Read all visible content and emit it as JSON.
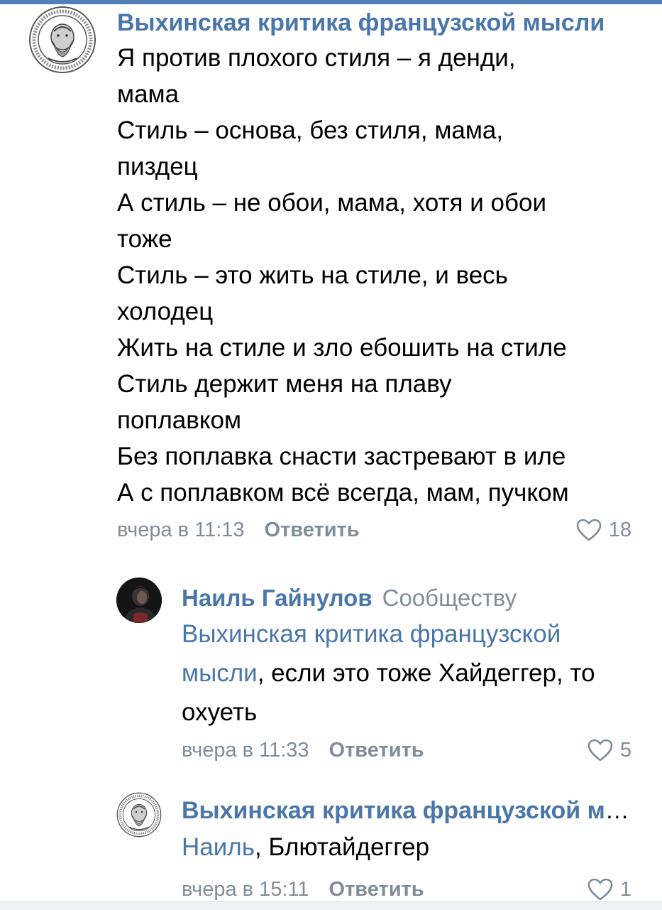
{
  "comments": [
    {
      "author": "Выхинская критика французской мысли",
      "lines": [
        "Я против плохого стиля – я денди,",
        "мама",
        "Стиль – основа, без стиля, мама,",
        "пиздец",
        "А стиль – не обои, мама, хотя и обои",
        "тоже",
        "Стиль – это жить на стиле, и весь",
        "холодец",
        "Жить на стиле и зло ебошить на стиле",
        "Стиль держит меня на плаву",
        "поплавком",
        "Без поплавка снасти застревают в иле",
        "А с поплавком всё всегда, мам, пучком"
      ],
      "time": "вчера в 11:13",
      "reply_label": "Ответить",
      "likes": "18",
      "avatar_icon": "community-logo-icon"
    },
    {
      "author": "Наиль Гайнулов",
      "addressee": "Сообществу",
      "mention": "Выхинская критика французской мысли",
      "text_after_mention": ", если это тоже Хайдеггер, то охуеть",
      "time": "вчера в 11:33",
      "reply_label": "Ответить",
      "likes": "5",
      "avatar_icon": "user-avatar-icon"
    },
    {
      "author": "Выхинская критика французской мысли",
      "mention": "Наиль",
      "text_after_mention": ", Блютайдеггер",
      "time": "вчера в 15:11",
      "reply_label": "Ответить",
      "likes": "1",
      "avatar_icon": "community-logo-icon"
    }
  ],
  "colors": {
    "link": "#4a76a8",
    "meta": "#818c99",
    "accent_bar": "#5181b8"
  }
}
